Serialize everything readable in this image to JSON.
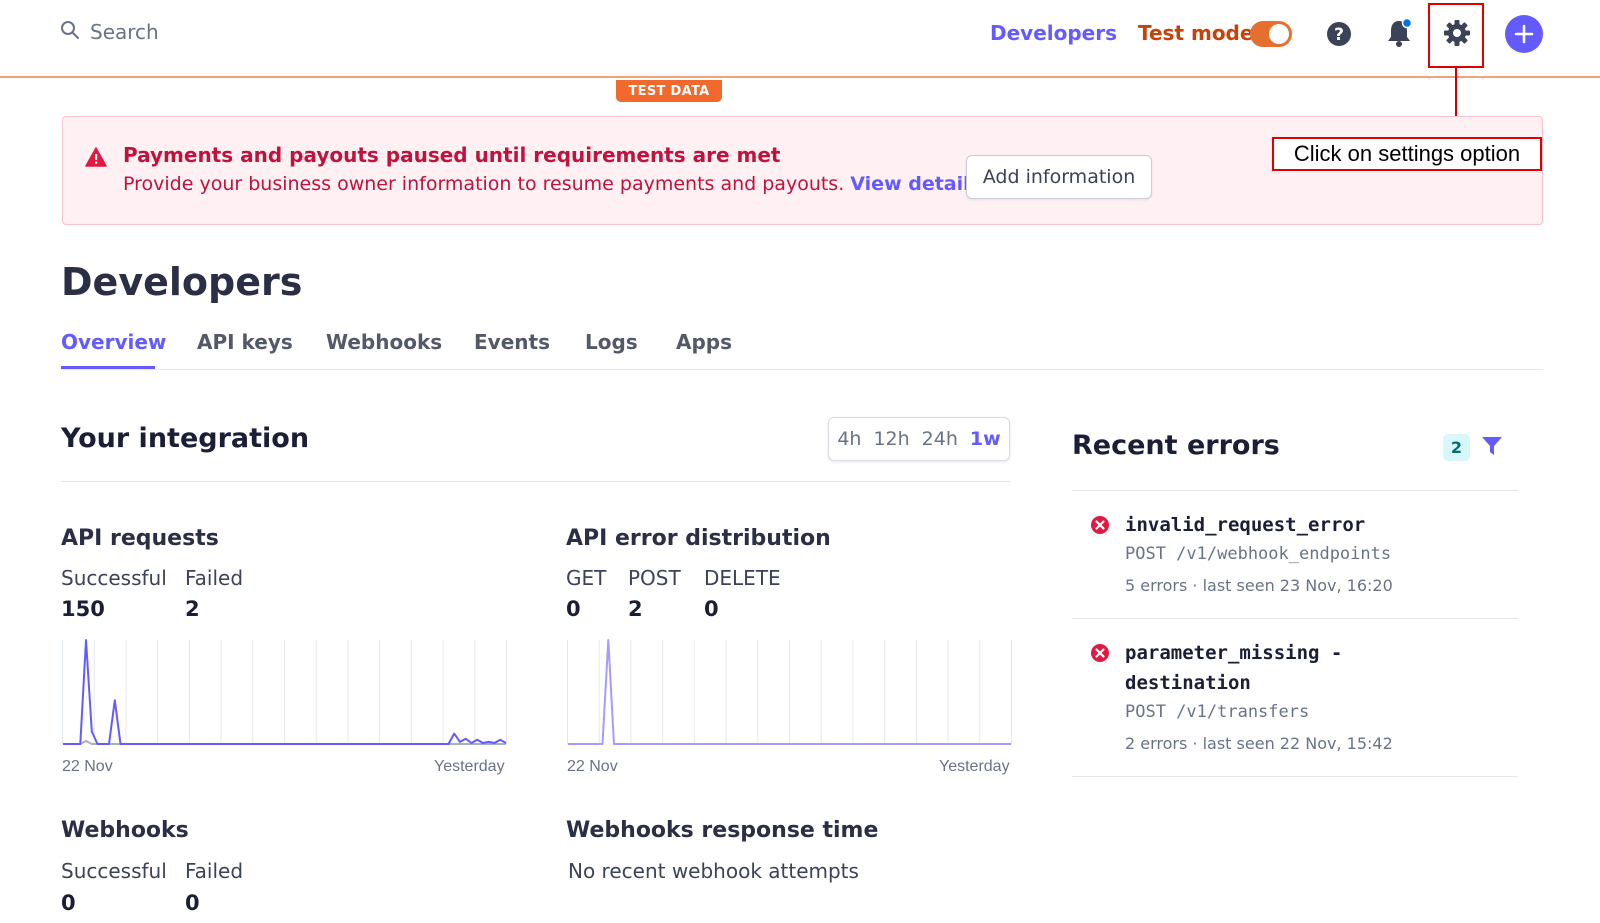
{
  "topbar": {
    "search_label": "Search",
    "developers_link": "Developers",
    "test_mode_label": "Test mode",
    "test_mode_on": true,
    "icons": [
      "search-icon",
      "help-icon",
      "bell-icon",
      "gear-icon",
      "plus-icon"
    ],
    "accent_color": "#635bff",
    "test_mode_color": "#e56f2f"
  },
  "annotation": {
    "text": "Click on settings option"
  },
  "test_data_badge": "TEST DATA",
  "alert": {
    "title": "Payments and payouts paused until requirements are met",
    "body": "Provide your business owner information to resume payments and payouts.",
    "link": "View details",
    "button": "Add information"
  },
  "page": {
    "title": "Developers",
    "tabs": [
      {
        "label": "Overview",
        "active": true
      },
      {
        "label": "API keys",
        "active": false
      },
      {
        "label": "Webhooks",
        "active": false
      },
      {
        "label": "Events",
        "active": false
      },
      {
        "label": "Logs",
        "active": false
      },
      {
        "label": "Apps",
        "active": false
      }
    ]
  },
  "integration": {
    "title": "Your integration",
    "ranges": [
      "4h",
      "12h",
      "24h",
      "1w"
    ],
    "selected_range": "1w",
    "api_requests": {
      "title": "API requests",
      "labels": [
        "Successful",
        "Failed"
      ],
      "values": [
        "150",
        "2"
      ],
      "x_start": "22 Nov",
      "x_end": "Yesterday"
    },
    "api_errors": {
      "title": "API error distribution",
      "labels": [
        "GET",
        "POST",
        "DELETE"
      ],
      "values": [
        "0",
        "2",
        "0"
      ],
      "x_start": "22 Nov",
      "x_end": "Yesterday"
    },
    "webhooks": {
      "title": "Webhooks",
      "labels": [
        "Successful",
        "Failed"
      ],
      "values": [
        "0",
        "0"
      ]
    },
    "webhooks_response": {
      "title": "Webhooks response time",
      "empty_text": "No recent webhook attempts"
    }
  },
  "recent_errors": {
    "title": "Recent errors",
    "count": "2",
    "items": [
      {
        "code": "invalid_request_error",
        "path": "POST /v1/webhook_endpoints",
        "meta": "5 errors · last seen 23 Nov, 16:20"
      },
      {
        "code": "parameter_missing - destination",
        "path": "POST /v1/transfers",
        "meta": "2 errors · last seen 22 Nov, 15:42"
      }
    ]
  },
  "chart_data": [
    {
      "type": "line",
      "series": [
        {
          "name": "Successful",
          "values": [
            0,
            0,
            0,
            0,
            100,
            12,
            0,
            0,
            0,
            42,
            0,
            0,
            0,
            0,
            0,
            0,
            0,
            0,
            0,
            0,
            0,
            0,
            0,
            0,
            0,
            0,
            0,
            0,
            0,
            0,
            0,
            0,
            0,
            0,
            0,
            0,
            0,
            0,
            0,
            0,
            0,
            0,
            0,
            0,
            0,
            0,
            0,
            0,
            0,
            0,
            0,
            0,
            0,
            0,
            0,
            0,
            0,
            0,
            0,
            0,
            0,
            0,
            0,
            0,
            0,
            0,
            0,
            0,
            10,
            2,
            5,
            1,
            4,
            1,
            2,
            1,
            4,
            1
          ],
          "color": "#635bff"
        },
        {
          "name": "Failed",
          "values": [
            0,
            0,
            0,
            0,
            3,
            0,
            0,
            0,
            0,
            0,
            0,
            0,
            0,
            0,
            0,
            0,
            0,
            0,
            0,
            0,
            0,
            0,
            0,
            0,
            0,
            0,
            0,
            0,
            0,
            0,
            0,
            0,
            0,
            0,
            0,
            0,
            0,
            0,
            0,
            0,
            0,
            0,
            0,
            0,
            0,
            0,
            0,
            0,
            0,
            0,
            0,
            0,
            0,
            0,
            0,
            0,
            0,
            0,
            0,
            0,
            0,
            0,
            0,
            0,
            0,
            0,
            0,
            0,
            0,
            0,
            0,
            0,
            0,
            0,
            0,
            0,
            0,
            0
          ],
          "color": "#aab0bb"
        }
      ]
    },
    {
      "type": "line",
      "series": [
        {
          "name": "POST",
          "values": [
            0,
            0,
            0,
            0,
            0,
            0,
            0,
            20,
            0,
            0,
            0,
            0,
            0,
            0,
            0,
            0,
            0,
            0,
            0,
            0,
            0,
            0,
            0,
            0,
            0,
            0,
            0,
            0,
            0,
            0,
            0,
            0,
            0,
            0,
            0,
            0,
            0,
            0,
            0,
            0,
            0,
            0,
            0,
            0,
            0,
            0,
            0,
            0,
            0,
            0,
            0,
            0,
            0,
            0,
            0,
            0,
            0,
            0,
            0,
            0,
            0,
            0,
            0,
            0,
            0,
            0,
            0,
            0,
            0,
            0,
            0,
            0,
            0,
            0,
            0,
            0,
            0,
            0
          ],
          "color": "#a69bff"
        }
      ]
    }
  ]
}
